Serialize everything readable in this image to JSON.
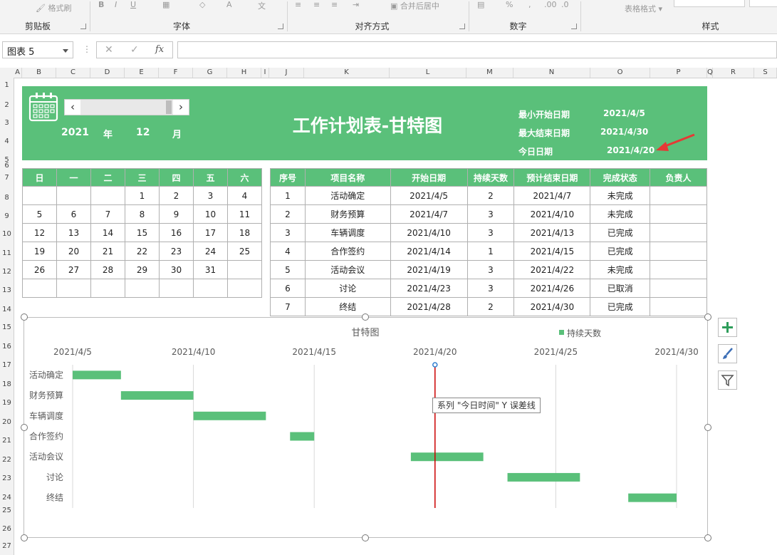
{
  "ribbon": {
    "groups": [
      "剪贴板",
      "字体",
      "对齐方式",
      "数字",
      "样式"
    ],
    "format_painter": "格式刷",
    "merge_center": "合并后居中",
    "table_format": "表格格式"
  },
  "formula_bar": {
    "name_box": "图表 5",
    "fx": "fx",
    "value": ""
  },
  "columns": [
    "A",
    "B",
    "C",
    "D",
    "E",
    "F",
    "G",
    "H",
    "I",
    "J",
    "K",
    "L",
    "M",
    "N",
    "O",
    "P",
    "Q",
    "R",
    "S"
  ],
  "rows": [
    "1",
    "2",
    "3",
    "4",
    "5",
    "6",
    "7",
    "8",
    "9",
    "10",
    "11",
    "12",
    "13",
    "14",
    "15",
    "16",
    "17",
    "18",
    "19",
    "20",
    "21",
    "22",
    "23",
    "24",
    "25",
    "26",
    "27"
  ],
  "banner": {
    "year": "2021",
    "year_unit": "年",
    "month": "12",
    "month_unit": "月",
    "title": "工作计划表-甘特图",
    "min_start_label": "最小开始日期",
    "min_start_value": "2021/4/5",
    "max_end_label": "最大结束日期",
    "max_end_value": "2021/4/30",
    "today_label": "今日日期",
    "today_value": "2021/4/20",
    "accent_color": "#5ac07a"
  },
  "calendar": {
    "headers": [
      "日",
      "一",
      "二",
      "三",
      "四",
      "五",
      "六"
    ],
    "weeks": [
      [
        "",
        "",
        "",
        "1",
        "2",
        "3",
        "4"
      ],
      [
        "5",
        "6",
        "7",
        "8",
        "9",
        "10",
        "11"
      ],
      [
        "12",
        "13",
        "14",
        "15",
        "16",
        "17",
        "18"
      ],
      [
        "19",
        "20",
        "21",
        "22",
        "23",
        "24",
        "25"
      ],
      [
        "26",
        "27",
        "28",
        "29",
        "30",
        "31",
        ""
      ],
      [
        "",
        "",
        "",
        "",
        "",
        "",
        ""
      ]
    ]
  },
  "tasks": {
    "headers": [
      "序号",
      "项目名称",
      "开始日期",
      "持续天数",
      "预计结束日期",
      "完成状态",
      "负责人"
    ],
    "rows": [
      [
        "1",
        "活动确定",
        "2021/4/5",
        "2",
        "2021/4/7",
        "未完成",
        ""
      ],
      [
        "2",
        "财务预算",
        "2021/4/7",
        "3",
        "2021/4/10",
        "未完成",
        ""
      ],
      [
        "3",
        "车辆调度",
        "2021/4/10",
        "3",
        "2021/4/13",
        "已完成",
        ""
      ],
      [
        "4",
        "合作签约",
        "2021/4/14",
        "1",
        "2021/4/15",
        "已完成",
        ""
      ],
      [
        "5",
        "活动会议",
        "2021/4/19",
        "3",
        "2021/4/22",
        "未完成",
        ""
      ],
      [
        "6",
        "讨论",
        "2021/4/23",
        "3",
        "2021/4/26",
        "已取消",
        ""
      ],
      [
        "7",
        "终结",
        "2021/4/28",
        "2",
        "2021/4/30",
        "已完成",
        ""
      ]
    ]
  },
  "chart_data": {
    "type": "bar",
    "orientation": "horizontal-stacked-gantt",
    "title": "甘特图",
    "legend": [
      "持续天数"
    ],
    "legend_position": "top-right",
    "x_tick_labels": [
      "2021/4/5",
      "2021/4/10",
      "2021/4/15",
      "2021/4/20",
      "2021/4/25",
      "2021/4/30"
    ],
    "x_range": [
      "2021/4/5",
      "2021/4/30"
    ],
    "x_axis_position": "top",
    "categories": [
      "活动确定",
      "财务预算",
      "车辆调度",
      "合作签约",
      "活动会议",
      "讨论",
      "终结"
    ],
    "start_dates": [
      "2021/4/5",
      "2021/4/7",
      "2021/4/10",
      "2021/4/14",
      "2021/4/19",
      "2021/4/23",
      "2021/4/28"
    ],
    "series": [
      {
        "name": "持续天数",
        "values": [
          2,
          3,
          3,
          1,
          3,
          3,
          2
        ],
        "color": "#5ac07a"
      }
    ],
    "today_line": {
      "date": "2021/4/20",
      "color": "#cc0000"
    },
    "gridlines": true,
    "tooltip": "系列 \"今日时间\" Y 误差线"
  }
}
